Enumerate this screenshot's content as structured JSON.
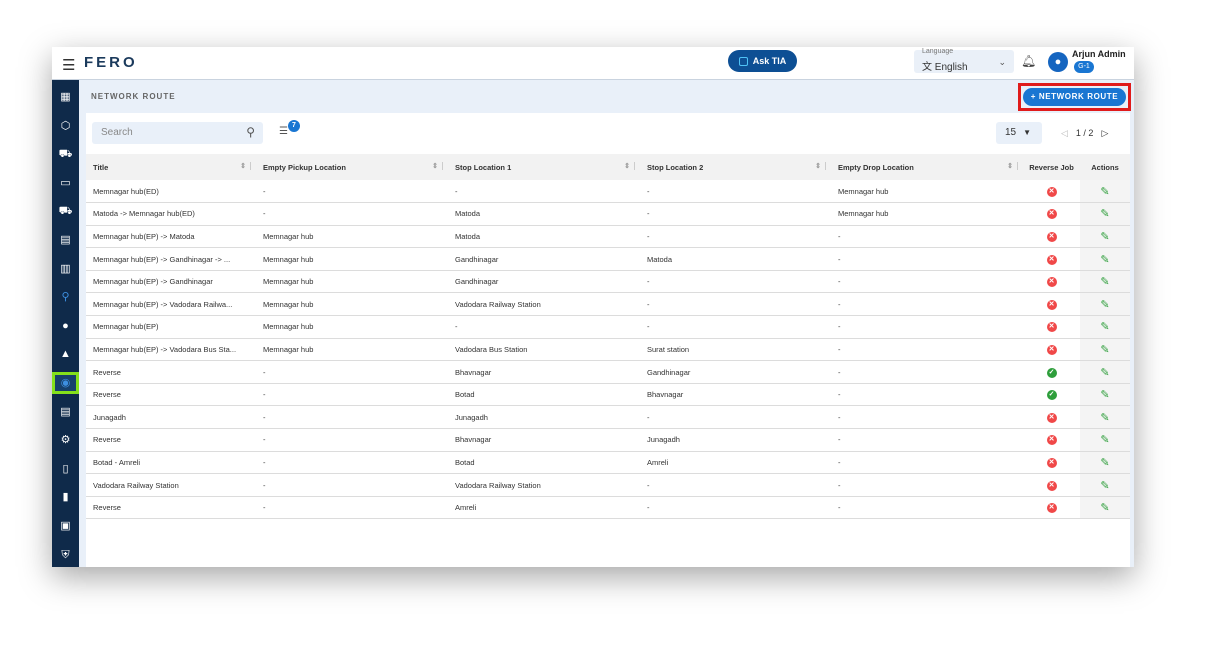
{
  "header": {
    "logo": "FERO",
    "ask_tia": "Ask TIA",
    "language_label": "Language",
    "language_value": "English",
    "user_name": "Arjun Admin",
    "user_badge": "G-1"
  },
  "sidebar": {
    "items": [
      {
        "icon": "dashboard-icon",
        "glyph": "▦"
      },
      {
        "icon": "package-add-icon",
        "glyph": "⬡"
      },
      {
        "icon": "bus-clock-icon",
        "glyph": "⛟"
      },
      {
        "icon": "money-icon",
        "glyph": "▭"
      },
      {
        "icon": "truck-icon",
        "glyph": "⛟"
      },
      {
        "icon": "grid-doc-icon",
        "glyph": "▤"
      },
      {
        "icon": "building-icon",
        "glyph": "▥"
      },
      {
        "icon": "route-icon",
        "glyph": "⚲"
      },
      {
        "icon": "location-pin-icon",
        "glyph": "●"
      },
      {
        "icon": "road-icon",
        "glyph": "▲"
      },
      {
        "icon": "network-route-icon",
        "glyph": "◉",
        "active": true
      },
      {
        "icon": "settings-list-icon",
        "glyph": "▤"
      },
      {
        "icon": "gear-icon",
        "glyph": "⚙"
      },
      {
        "icon": "document-export-icon",
        "glyph": "▯"
      },
      {
        "icon": "trash-icon",
        "glyph": "▮"
      },
      {
        "icon": "contact-icon",
        "glyph": "▣"
      },
      {
        "icon": "shield-icon",
        "glyph": "⛨"
      }
    ]
  },
  "page": {
    "title": "NETWORK ROUTE",
    "add_button": "+  NETWORK ROUTE",
    "search_placeholder": "Search",
    "filter_count": "7",
    "per_page": "15",
    "pagination": "1 / 2"
  },
  "colors": {
    "accent": "#1976d2",
    "sidebar": "#0f2a4a",
    "no": "#f04848",
    "yes": "#2e9e3b"
  },
  "table": {
    "columns": [
      "Title",
      "Empty Pickup Location",
      "Stop Location 1",
      "Stop Location 2",
      "Empty Drop Location",
      "Reverse Job",
      "Actions"
    ],
    "rows": [
      [
        "Memnagar hub(ED)",
        "-",
        "-",
        "-",
        "Memnagar hub",
        false
      ],
      [
        "Matoda -> Memnagar hub(ED)",
        "-",
        "Matoda",
        "-",
        "Memnagar hub",
        false
      ],
      [
        "Memnagar hub(EP) -> Matoda",
        "Memnagar hub",
        "Matoda",
        "-",
        "-",
        false
      ],
      [
        "Memnagar hub(EP) -> Gandhinagar -> ...",
        "Memnagar hub",
        "Gandhinagar",
        "Matoda",
        "-",
        false
      ],
      [
        "Memnagar hub(EP) -> Gandhinagar",
        "Memnagar hub",
        "Gandhinagar",
        "-",
        "-",
        false
      ],
      [
        "Memnagar hub(EP) -> Vadodara Railwa...",
        "Memnagar hub",
        "Vadodara Railway Station",
        "-",
        "-",
        false
      ],
      [
        "Memnagar hub(EP)",
        "Memnagar hub",
        "-",
        "-",
        "-",
        false
      ],
      [
        "Memnagar hub(EP) -> Vadodara Bus Sta...",
        "Memnagar hub",
        "Vadodara Bus Station",
        "Surat station",
        "-",
        false
      ],
      [
        "Reverse",
        "-",
        "Bhavnagar",
        "Gandhinagar",
        "-",
        true
      ],
      [
        "Reverse",
        "-",
        "Botad",
        "Bhavnagar",
        "-",
        true
      ],
      [
        "Junagadh",
        "-",
        "Junagadh",
        "-",
        "-",
        false
      ],
      [
        "Reverse",
        "-",
        "Bhavnagar",
        "Junagadh",
        "-",
        false
      ],
      [
        "Botad - Amreli",
        "-",
        "Botad",
        "Amreli",
        "-",
        false
      ],
      [
        "Vadodara Railway Station",
        "-",
        "Vadodara Railway Station",
        "-",
        "-",
        false
      ],
      [
        "Reverse",
        "-",
        "Amreli",
        "-",
        "-",
        false
      ]
    ]
  }
}
